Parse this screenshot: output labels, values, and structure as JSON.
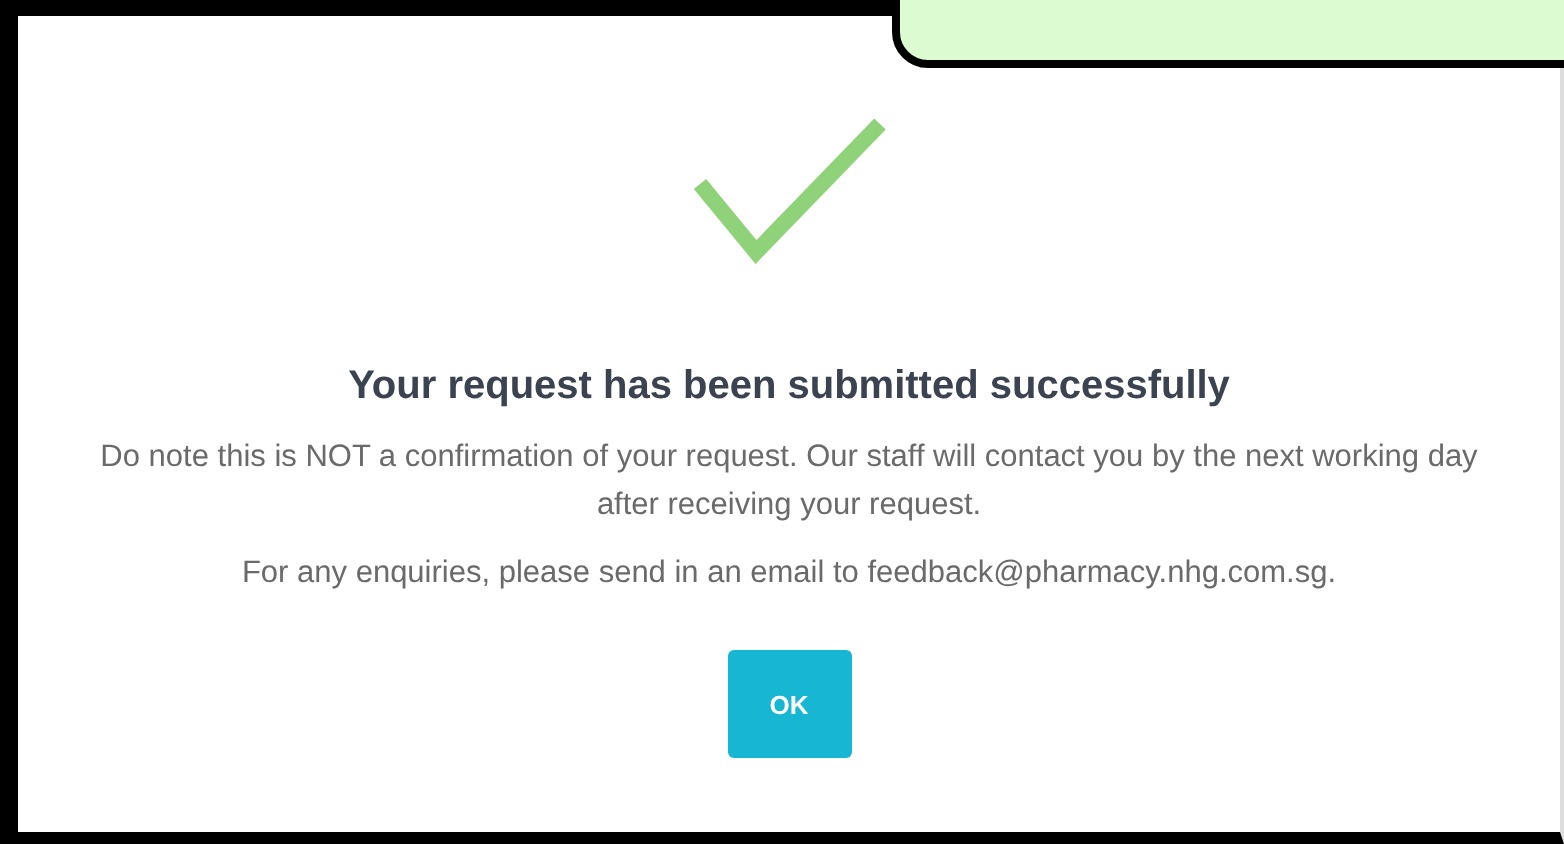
{
  "dialog": {
    "title": "Your request has been submitted successfully",
    "paragraphs": [
      "Do note this is NOT a confirmation of your request. Our staff will contact you by the next working day after receiving your request.",
      "For any enquiries, please send in an email to feedback@pharmacy.nhg.com.sg."
    ],
    "button": "OK"
  }
}
